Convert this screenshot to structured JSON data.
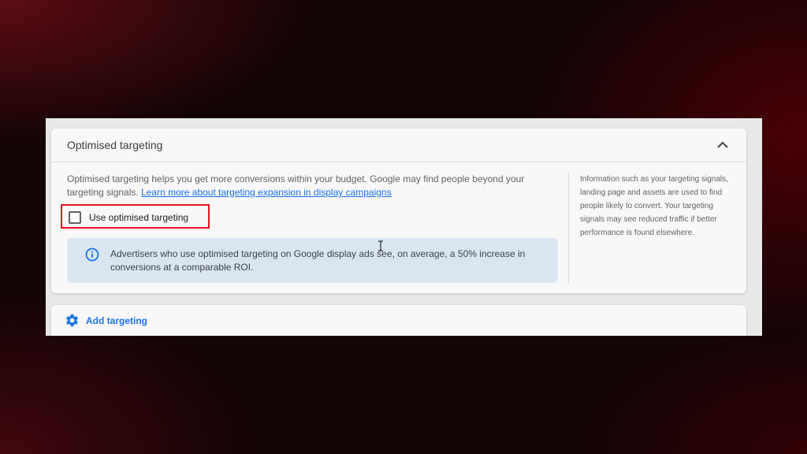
{
  "section": {
    "title": "Optimised targeting",
    "collapse_icon": "chevron-up-icon",
    "description": "Optimised targeting helps you get more conversions within your budget. Google may find people beyond your targeting signals.",
    "learn_more_link": "Learn more about targeting expansion in display campaigns",
    "checkbox": {
      "label": "Use optimised targeting",
      "checked": false
    },
    "info_banner": {
      "icon": "info-icon",
      "text": "Advertisers who use optimised targeting on Google display ads see, on average, a 50% increase in conversions at a comparable ROI."
    },
    "side_note": "Information such as your targeting signals, landing page and assets are used to find people likely to convert. Your targeting signals may see reduced traffic if better performance is found elsewhere."
  },
  "add_targeting": {
    "icon": "gear-icon",
    "label": "Add targeting"
  },
  "colors": {
    "accent": "#1a73e8",
    "highlight_border": "#e5121b",
    "info_background": "#d9e6f2"
  }
}
